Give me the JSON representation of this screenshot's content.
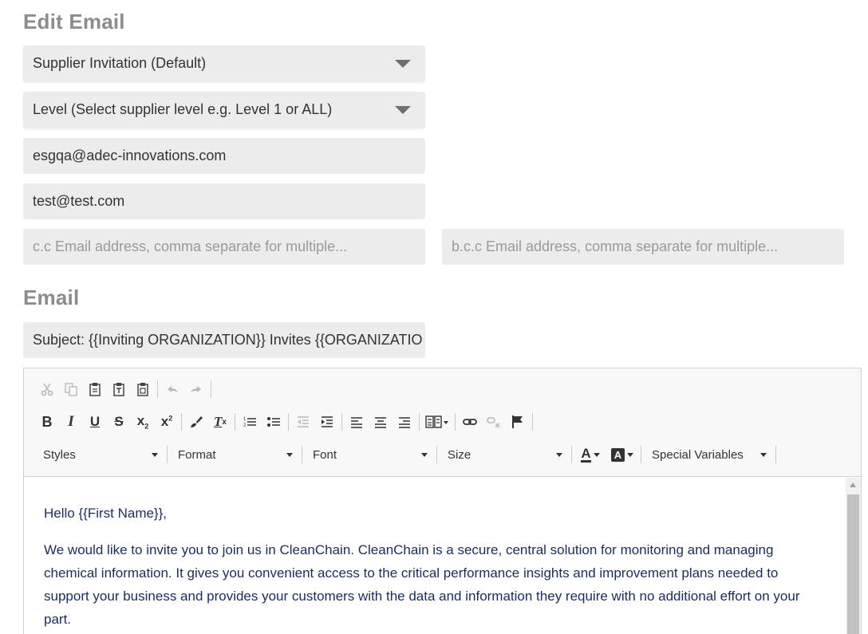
{
  "headings": {
    "edit_email": "Edit Email",
    "email": "Email"
  },
  "fields": {
    "template_select": "Supplier Invitation (Default)",
    "level_select": "Level (Select supplier level e.g. Level 1 or ALL)",
    "from_value": "esgqa@adec-innovations.com",
    "to_value": "test@test.com",
    "cc_placeholder": "c.c Email address, comma separate for multiple...",
    "bcc_placeholder": "b.c.c Email address, comma separate for multiple...",
    "subject_value": "Subject: {{Inviting ORGANIZATION}} Invites {{ORGANIZATIO"
  },
  "editor": {
    "toolbar": {
      "combos": {
        "styles": "Styles",
        "format": "Format",
        "font": "Font",
        "size": "Size",
        "special_variables": "Special Variables"
      },
      "icons": {
        "row1": [
          "cut-icon",
          "copy-icon",
          "paste-icon",
          "paste-text-icon",
          "paste-word-icon",
          "undo-icon",
          "redo-icon"
        ],
        "row2": [
          "bold-icon",
          "italic-icon",
          "underline-icon",
          "strikethrough-icon",
          "subscript-icon",
          "superscript-icon",
          "copy-formatting-icon",
          "remove-format-icon",
          "numbered-list-icon",
          "bulleted-list-icon",
          "outdent-icon",
          "indent-icon",
          "align-left-icon",
          "align-center-icon",
          "align-right-icon",
          "bidi-icon",
          "link-icon",
          "unlink-icon",
          "anchor-icon"
        ],
        "row3": [
          "text-color-icon",
          "background-color-icon"
        ]
      }
    },
    "content": {
      "greeting": "Hello {{First Name}},",
      "paragraph": "We would like to invite you to join us in CleanChain. CleanChain is a secure, central solution for monitoring and managing chemical information. It gives you convenient access to the critical performance insights and improvement plans needed to support your business and provides your customers with the data and information they require with no additional effort on your part."
    }
  },
  "colors": {
    "heading": "#8c8c8c",
    "field_bg": "#ececec",
    "editor_text": "#1a2d5a"
  }
}
